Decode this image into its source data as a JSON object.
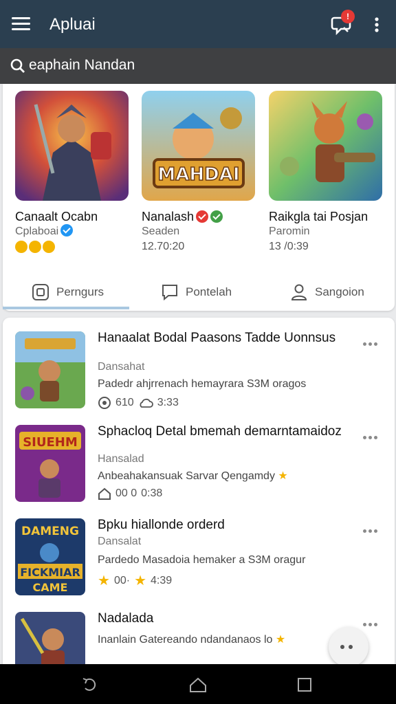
{
  "appbar": {
    "title": "Apluai",
    "badge_count": "!",
    "icons": {
      "menu": "menu-icon",
      "notification": "chat-notification-icon",
      "more": "more-vert-icon"
    }
  },
  "search": {
    "value": "eaphain Nandan",
    "icon": "search-icon"
  },
  "featured": [
    {
      "name": "Canaalt Ocabn",
      "sub": "Cplaboai",
      "sub_badge": "verified-blue",
      "meta": "emoji-reactions"
    },
    {
      "name": "Nanalash",
      "name_badges": [
        "verified-red",
        "verified-green"
      ],
      "sub": "Seaden",
      "meta": "12.70:20"
    },
    {
      "name": "Raikgla tai Posjan",
      "sub": "Paromin",
      "meta": "13 /0:39"
    }
  ],
  "tabs": [
    {
      "label": "Perngurs",
      "icon": "square-icon",
      "active": true
    },
    {
      "label": "Pontelah",
      "icon": "message-icon",
      "active": false
    },
    {
      "label": "Sangoion",
      "icon": "person-icon",
      "active": false
    }
  ],
  "list": [
    {
      "title": "Hanaalat Bodal Paasons Tadde Uonnsus",
      "developer": "Dansahat",
      "description": "Padedr ahjrrenach hemayrara S3M oragos",
      "stats": [
        "610",
        "3:33"
      ]
    },
    {
      "title": "Sphacloq Detal bmemah demarntamaidoz",
      "developer": "Hansalad",
      "description": "Anbeahakansuak Sarvar Qengamdy",
      "stats": [
        "00 0",
        "0:38"
      ]
    },
    {
      "title": "Bpku hiallonde orderd",
      "developer": "Dansalat",
      "description": "Pardedo Masadoia hemaker a S3M oragur",
      "stats": [
        "00·",
        "4:39"
      ]
    },
    {
      "title": "Nadalada",
      "developer": "",
      "description": "Inanlain Gatereando ndandanaos lo",
      "stats": []
    }
  ],
  "colors": {
    "appbar": "#2b3f50",
    "search": "#3f4042",
    "badge": "#e53935",
    "verified_blue": "#2196f3",
    "star": "#f4b400",
    "tab_indicator": "#a9c8e0"
  },
  "navbar": {
    "back": "back-icon",
    "home": "home-icon",
    "recents": "recents-icon"
  }
}
